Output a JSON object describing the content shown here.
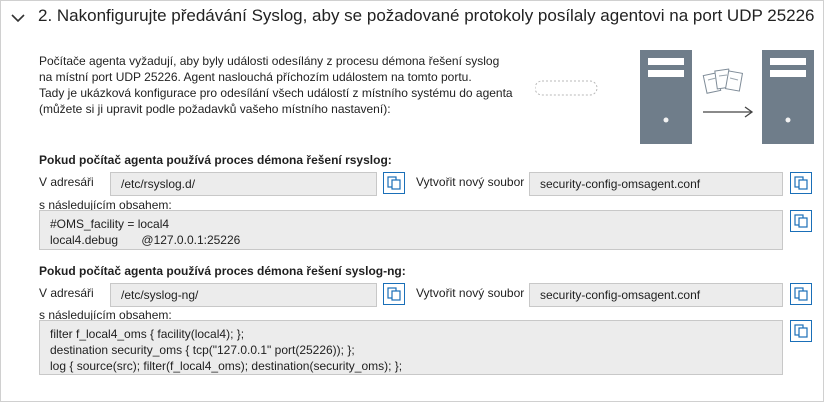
{
  "header": {
    "title": "2. Nakonfigurujte předávání Syslog, aby se požadované protokoly posílaly agentovi na port UDP 25226",
    "chevron_icon": "chevron-down-icon"
  },
  "intro": {
    "lines": [
      "Počítače agenta vyžadují, aby byly události odesílány z procesu démona řešení syslog",
      "na místní port UDP 25226. Agent naslouchá příchozím událostem na tomto portu.",
      "Tady je ukázková konfigurace pro odesílání všech událostí z místního systému do agenta",
      "(můžete si ji upravit podle požadavků vašeho místního nastavení):"
    ]
  },
  "illustration": {
    "icons": [
      "server-icon",
      "documents-icon",
      "arrow-right-icon",
      "server-icon"
    ]
  },
  "rsyslog": {
    "title": "Pokud počítač agenta používá proces démona řešení rsyslog:",
    "dir_label": "V adresáři",
    "dir_value": "/etc/rsyslog.d/",
    "file_label": "Vytvořit nový soubor",
    "file_value": "security-config-omsagent.conf",
    "content_label": "s následujícím obsahem:",
    "content_lines": [
      "#OMS_facility = local4",
      "local4.debug       @127.0.0.1:25226"
    ]
  },
  "syslogng": {
    "title": "Pokud počítač agenta používá proces démona řešení syslog-ng:",
    "dir_label": "V adresáři",
    "dir_value": "/etc/syslog-ng/",
    "file_label": "Vytvořit nový soubor",
    "file_value": "security-config-omsagent.conf",
    "content_label": "s následujícím obsahem:",
    "content_lines": [
      "filter f_local4_oms { facility(local4); };",
      "destination security_oms { tcp(\"127.0.0.1\" port(25226)); };",
      "log { source(src); filter(f_local4_oms); destination(security_oms); };"
    ]
  },
  "colors": {
    "accent": "#1a6fb8",
    "field_bg": "#ececec",
    "server": "#6f7d8a"
  }
}
